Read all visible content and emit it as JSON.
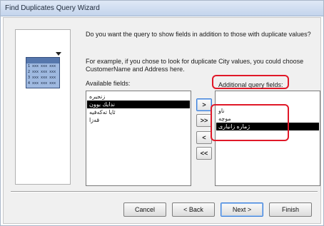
{
  "window": {
    "title": "Find Duplicates Query Wizard"
  },
  "illustration": {
    "rows": [
      "1 xxx xxx xxx",
      "2 xxx xxx xxx",
      "3 xxx xxx xxx",
      "4 xxx xxx xxx"
    ]
  },
  "prompt": {
    "question": "Do you want the query to show fields in addition to those with duplicate values?",
    "example": "For example, if you chose to look for duplicate City values, you could choose CustomerName and Address here."
  },
  "available": {
    "label": "Available fields:",
    "items": [
      {
        "text": "زنجیرە",
        "selected": false
      },
      {
        "text": "ندایك بوون",
        "selected": true
      },
      {
        "text": "ئایا تەکەفیە",
        "selected": false
      },
      {
        "text": "قەزا",
        "selected": false
      }
    ]
  },
  "additional": {
    "label": "Additional query fields:",
    "items": [
      {
        "text": "ناو",
        "selected": false
      },
      {
        "text": "موچە",
        "selected": false
      },
      {
        "text": "ژمارە زانیاری",
        "selected": true
      }
    ]
  },
  "move_buttons": {
    "add_one": ">",
    "add_all": ">>",
    "remove_one": "<",
    "remove_all": "<<"
  },
  "footer": {
    "cancel": "Cancel",
    "back": "< Back",
    "next": "Next >",
    "finish": "Finish"
  },
  "colors": {
    "highlight": "#e01828",
    "selection": "#000000"
  }
}
